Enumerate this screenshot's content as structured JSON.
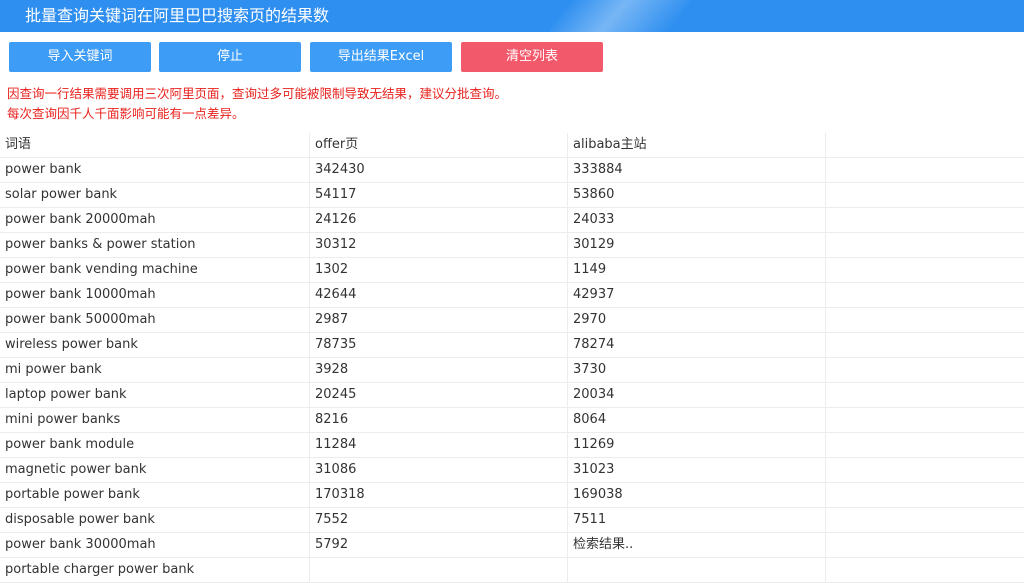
{
  "window": {
    "title": "批量查询关键词在阿里巴巴搜索页的结果数"
  },
  "toolbar": {
    "import_label": "导入关键词",
    "stop_label": "停止",
    "export_label": "导出结果Excel",
    "clear_label": "清空列表"
  },
  "notice": {
    "line1": "因查询一行结果需要调用三次阿里页面，查询过多可能被限制导致无结果，建议分批查询。",
    "line2": "每次查询因千人千面影响可能有一点差异。"
  },
  "table": {
    "headers": [
      "词语",
      "offer页",
      "alibaba主站",
      ""
    ],
    "rows": [
      [
        "power bank",
        "342430",
        "333884"
      ],
      [
        "solar power bank",
        "54117",
        "53860"
      ],
      [
        "power bank 20000mah",
        "24126",
        "24033"
      ],
      [
        "power banks & power station",
        "30312",
        "30129"
      ],
      [
        "power bank vending machine",
        "1302",
        "1149"
      ],
      [
        "power bank 10000mah",
        "42644",
        "42937"
      ],
      [
        "power bank 50000mah",
        "2987",
        "2970"
      ],
      [
        "wireless power bank",
        "78735",
        "78274"
      ],
      [
        "mi power bank",
        "3928",
        "3730"
      ],
      [
        "laptop power bank",
        "20245",
        "20034"
      ],
      [
        "mini power banks",
        "8216",
        "8064"
      ],
      [
        "power bank module",
        "11284",
        "11269"
      ],
      [
        "magnetic power bank",
        "31086",
        "31023"
      ],
      [
        "portable power bank",
        "170318",
        "169038"
      ],
      [
        "disposable power bank",
        "7552",
        "7511"
      ],
      [
        "power bank 30000mah",
        "5792",
        "检索结果.."
      ],
      [
        "portable charger power bank",
        "",
        ""
      ]
    ]
  },
  "colors": {
    "titlebar": "#2e8ff0",
    "button_blue": "#3d9cf5",
    "button_red": "#f25a6c",
    "notice_text": "#e8211c"
  }
}
